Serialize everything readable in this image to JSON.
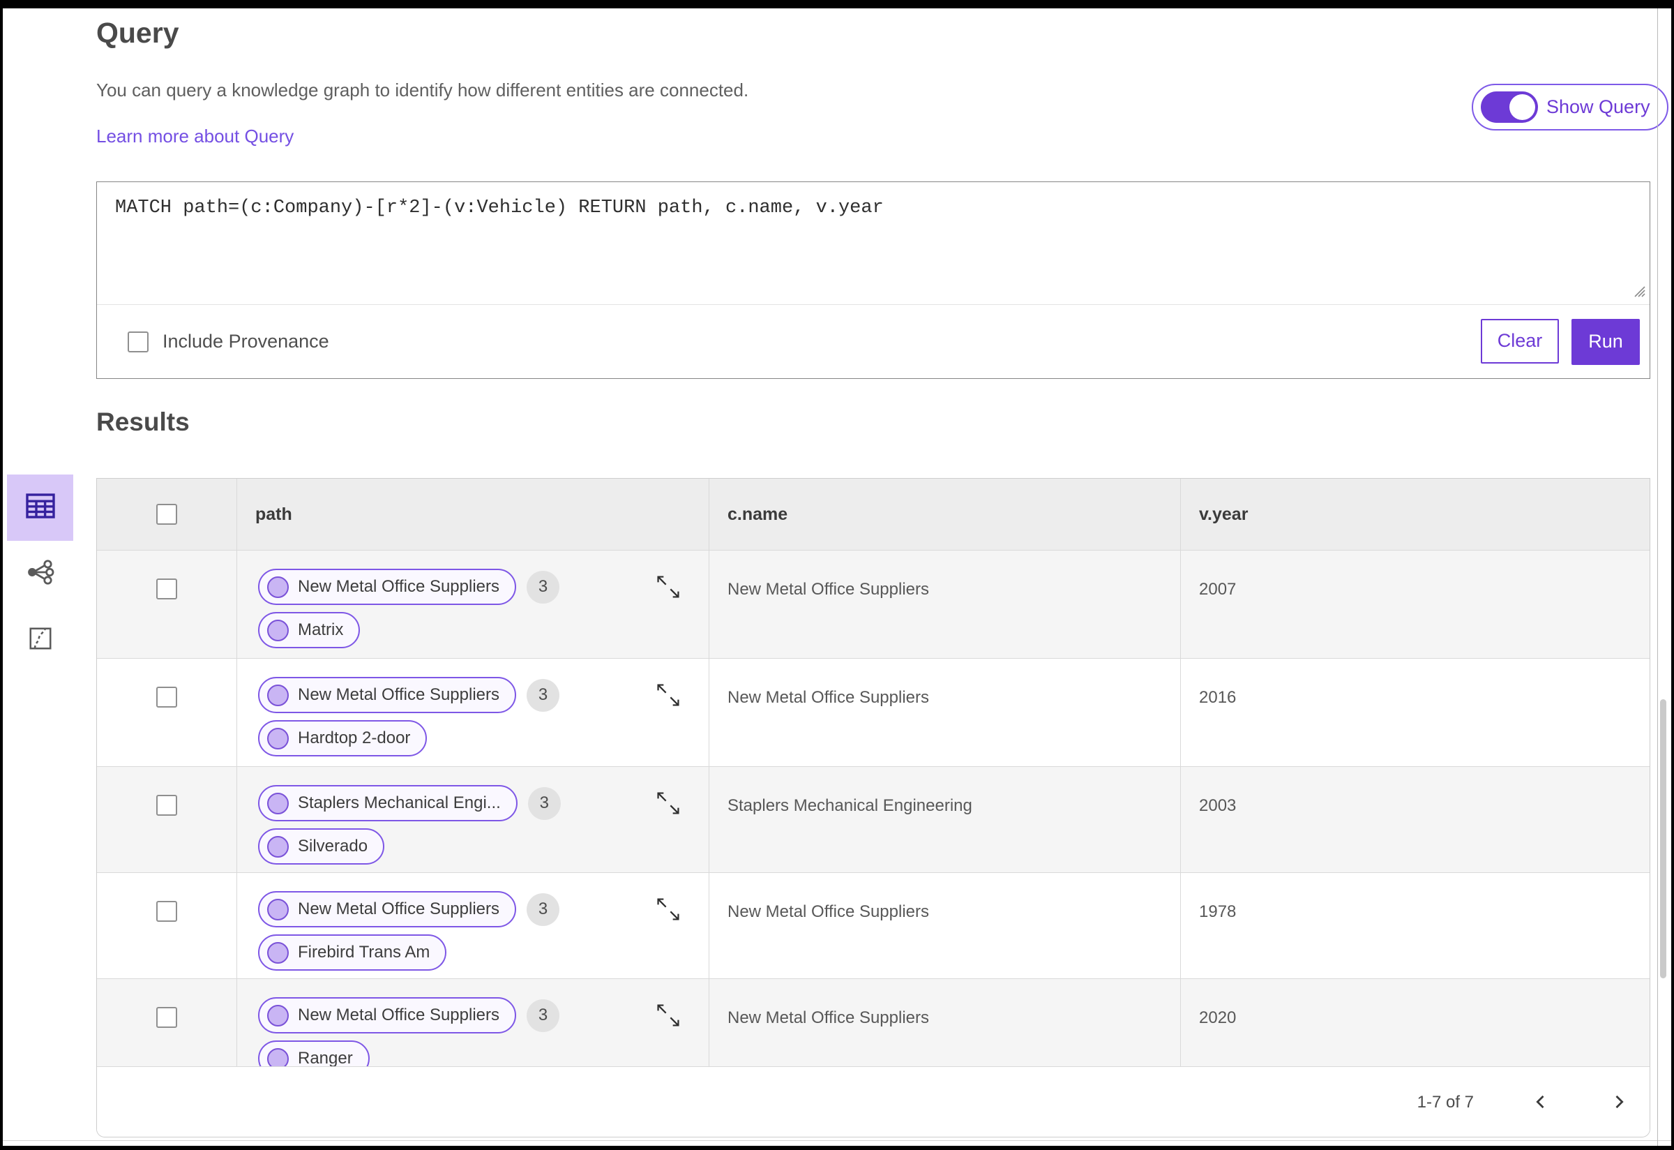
{
  "header": {
    "title": "Query",
    "description": "You can query a knowledge graph to identify how different entities are connected.",
    "learn_more_label": "Learn more about Query",
    "show_query_label": "Show Query",
    "show_query_on": true
  },
  "query_editor": {
    "query_text": "MATCH path=(c:Company)-[r*2]-(v:Vehicle) RETURN path, c.name, v.year",
    "include_provenance_label": "Include Provenance",
    "include_provenance_checked": false,
    "clear_label": "Clear",
    "run_label": "Run"
  },
  "results": {
    "title": "Results",
    "views": {
      "selected": "table-view",
      "items": [
        "table-view",
        "graph-view",
        "chart-view"
      ]
    },
    "columns": {
      "path": "path",
      "c_name": "c.name",
      "v_year": "v.year"
    },
    "rows": [
      {
        "path_nodes": [
          "New Metal Office Suppliers",
          "Matrix"
        ],
        "edge_count": "3",
        "c_name": "New Metal Office Suppliers",
        "v_year": "2007"
      },
      {
        "path_nodes": [
          "New Metal Office Suppliers",
          "Hardtop 2-door"
        ],
        "edge_count": "3",
        "c_name": "New Metal Office Suppliers",
        "v_year": "2016"
      },
      {
        "path_nodes": [
          "Staplers Mechanical Engi...",
          "Silverado"
        ],
        "edge_count": "3",
        "c_name": "Staplers Mechanical Engineering",
        "v_year": "2003"
      },
      {
        "path_nodes": [
          "New Metal Office Suppliers",
          "Firebird Trans Am"
        ],
        "edge_count": "3",
        "c_name": "New Metal Office Suppliers",
        "v_year": "1978"
      },
      {
        "path_nodes": [
          "New Metal Office Suppliers",
          "Ranger"
        ],
        "edge_count": "3",
        "c_name": "New Metal Office Suppliers",
        "v_year": "2020"
      }
    ],
    "pagination": {
      "range_label": "1-7 of 7"
    }
  },
  "icons": {
    "toggle": "toggle-on-icon",
    "table_view": "table-grid-icon",
    "graph_view": "network-share-icon",
    "chart_view": "route-map-icon",
    "expand": "expand-diagonal-arrows-icon",
    "prev": "chevron-left-icon",
    "next": "chevron-right-icon",
    "resize": "textarea-resize-grip-icon"
  },
  "colors": {
    "accent": "#6d3ad6",
    "accent_outline": "#7e57e6",
    "accent_bg_light": "#d8c8f8",
    "pill_bg": "#faf8ff",
    "node_dot_fill": "#c9b5f4",
    "table_header_bg": "#ededed",
    "row_alt_bg": "#f5f5f5",
    "badge_bg": "#e2e2e2",
    "link": "#744fe3"
  }
}
